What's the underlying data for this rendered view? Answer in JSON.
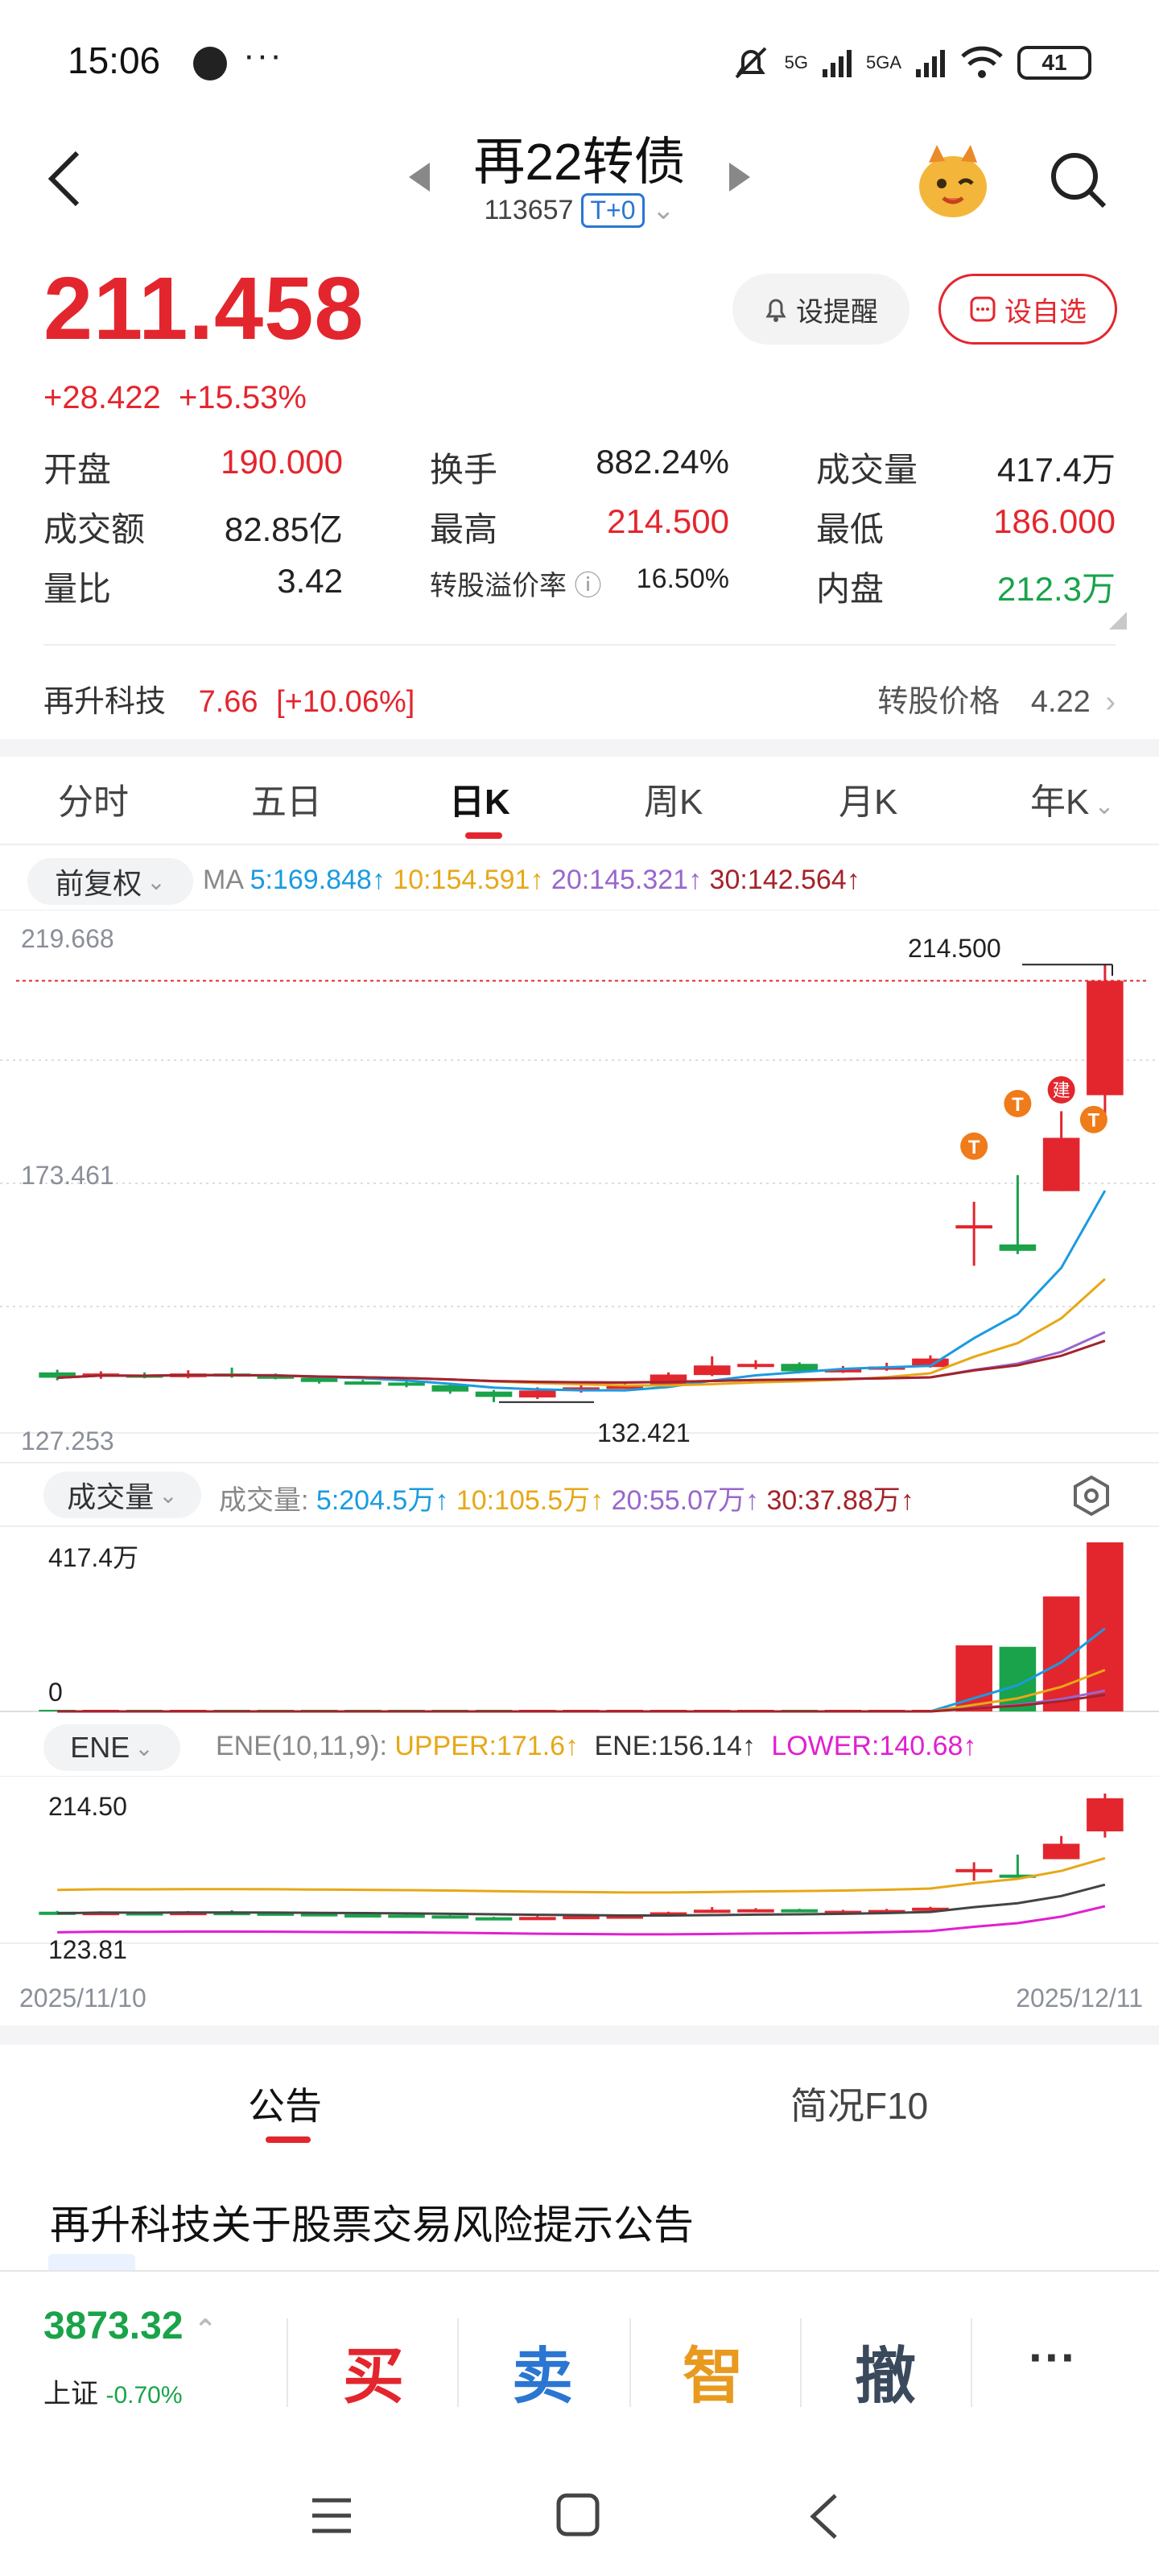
{
  "status_bar": {
    "time": "15:06",
    "more": "···",
    "signal1": "5G",
    "signal2": "5GA",
    "battery": "41"
  },
  "header": {
    "title": "再22转债",
    "code": "113657",
    "tag": "T+0"
  },
  "quote": {
    "price": "211.458",
    "change_abs": "+28.422",
    "change_pct": "+15.53%",
    "alert_label": "设提醒",
    "watch_label": "设自选",
    "colors": {
      "up": "#e3262e",
      "down": "#1aa34a"
    }
  },
  "stats": {
    "open_label": "开盘",
    "open": "190.000",
    "turnover_label": "换手",
    "turnover": "882.24%",
    "volume_label": "成交量",
    "volume": "417.4万",
    "amount_label": "成交额",
    "amount": "82.85亿",
    "high_label": "最高",
    "high": "214.500",
    "low_label": "最低",
    "low": "186.000",
    "vol_ratio_label": "量比",
    "vol_ratio": "3.42",
    "premium_label": "转股溢价率",
    "premium": "16.50%",
    "inner_label": "内盘",
    "inner": "212.3万"
  },
  "underlying": {
    "name": "再升科技",
    "price": "7.66",
    "change": "[+10.06%]",
    "conv_label": "转股价格",
    "conv_price": "4.22"
  },
  "tabs": [
    "分时",
    "五日",
    "日K",
    "周K",
    "月K",
    "年K"
  ],
  "active_tab": "日K",
  "ma": {
    "adjust_label": "前复权",
    "prefix": "MA",
    "ma5": "5:169.848↑",
    "ma10": "10:154.591↑",
    "ma20": "20:145.321↑",
    "ma30": "30:142.564↑",
    "colors": {
      "ma5": "#1a9be0",
      "ma10": "#e6a817",
      "ma20": "#9966cc",
      "ma30": "#a4232a"
    }
  },
  "kline": {
    "y_top": "219.668",
    "y_mid": "173.461",
    "y_bottom": "127.253",
    "high_label": "214.500",
    "low_label": "132.421"
  },
  "volume": {
    "chip": "成交量",
    "prefix": "成交量:",
    "v5": "5:204.5万↑",
    "v10": "10:105.5万↑",
    "v20": "20:55.07万↑",
    "v30": "30:37.88万↑",
    "y_top": "417.4万",
    "y_bottom": "0"
  },
  "ene": {
    "chip": "ENE",
    "prefix": "ENE(10,11,9):",
    "upper": "UPPER:171.6↑",
    "ene": "ENE:156.14↑",
    "lower": "LOWER:140.68↑",
    "y_top": "214.50",
    "y_bottom": "123.81",
    "date_start": "2025/11/10",
    "date_end": "2025/12/11"
  },
  "markers": {
    "t": "T",
    "jian": "建"
  },
  "chart_data": {
    "type": "candlestick",
    "title": "再22转债 日K",
    "x": [
      "2025/11/10",
      "2025/12/11"
    ],
    "ylim": [
      127.253,
      219.668
    ],
    "series": [
      {
        "name": "MA5",
        "latest": 169.848
      },
      {
        "name": "MA10",
        "latest": 154.591
      },
      {
        "name": "MA20",
        "latest": 145.321
      },
      {
        "name": "MA30",
        "latest": 142.564
      }
    ],
    "candles": [
      {
        "o": 138.0,
        "c": 137.0,
        "h": 138.5,
        "l": 136.5
      },
      {
        "o": 137.2,
        "c": 137.8,
        "h": 138.2,
        "l": 136.8
      },
      {
        "o": 137.6,
        "c": 137.3,
        "h": 138.0,
        "l": 136.9
      },
      {
        "o": 137.1,
        "c": 137.8,
        "h": 138.4,
        "l": 136.9
      },
      {
        "o": 137.8,
        "c": 137.5,
        "h": 138.9,
        "l": 137.0
      },
      {
        "o": 137.4,
        "c": 137.0,
        "h": 137.8,
        "l": 136.7
      },
      {
        "o": 137.0,
        "c": 136.2,
        "h": 137.2,
        "l": 135.9
      },
      {
        "o": 136.3,
        "c": 136.1,
        "h": 136.6,
        "l": 135.7
      },
      {
        "o": 136.1,
        "c": 135.6,
        "h": 136.5,
        "l": 135.2
      },
      {
        "o": 135.6,
        "c": 134.4,
        "h": 135.8,
        "l": 134.0
      },
      {
        "o": 134.4,
        "c": 133.4,
        "h": 134.7,
        "l": 132.421
      },
      {
        "o": 133.3,
        "c": 134.6,
        "h": 135.2,
        "l": 133.0
      },
      {
        "o": 134.6,
        "c": 135.2,
        "h": 135.9,
        "l": 134.2
      },
      {
        "o": 135.2,
        "c": 135.5,
        "h": 136.2,
        "l": 134.9
      },
      {
        "o": 135.6,
        "c": 137.6,
        "h": 138.0,
        "l": 135.4
      },
      {
        "o": 137.5,
        "c": 139.3,
        "h": 141.0,
        "l": 137.3
      },
      {
        "o": 139.3,
        "c": 139.6,
        "h": 140.3,
        "l": 138.6
      },
      {
        "o": 139.6,
        "c": 138.2,
        "h": 139.9,
        "l": 137.8
      },
      {
        "o": 138.3,
        "c": 138.6,
        "h": 139.2,
        "l": 137.9
      },
      {
        "o": 138.6,
        "c": 139.1,
        "h": 139.8,
        "l": 138.3
      },
      {
        "o": 139.0,
        "c": 140.6,
        "h": 141.2,
        "l": 138.9
      },
      {
        "o": 165.2,
        "c": 165.6,
        "h": 170.0,
        "l": 158.0
      },
      {
        "o": 162.0,
        "c": 160.8,
        "h": 175.0,
        "l": 160.2
      },
      {
        "o": 172.0,
        "c": 182.0,
        "h": 187.0,
        "l": 172.0
      },
      {
        "o": 190.0,
        "c": 211.458,
        "h": 214.5,
        "l": 186.0
      }
    ]
  }
}
